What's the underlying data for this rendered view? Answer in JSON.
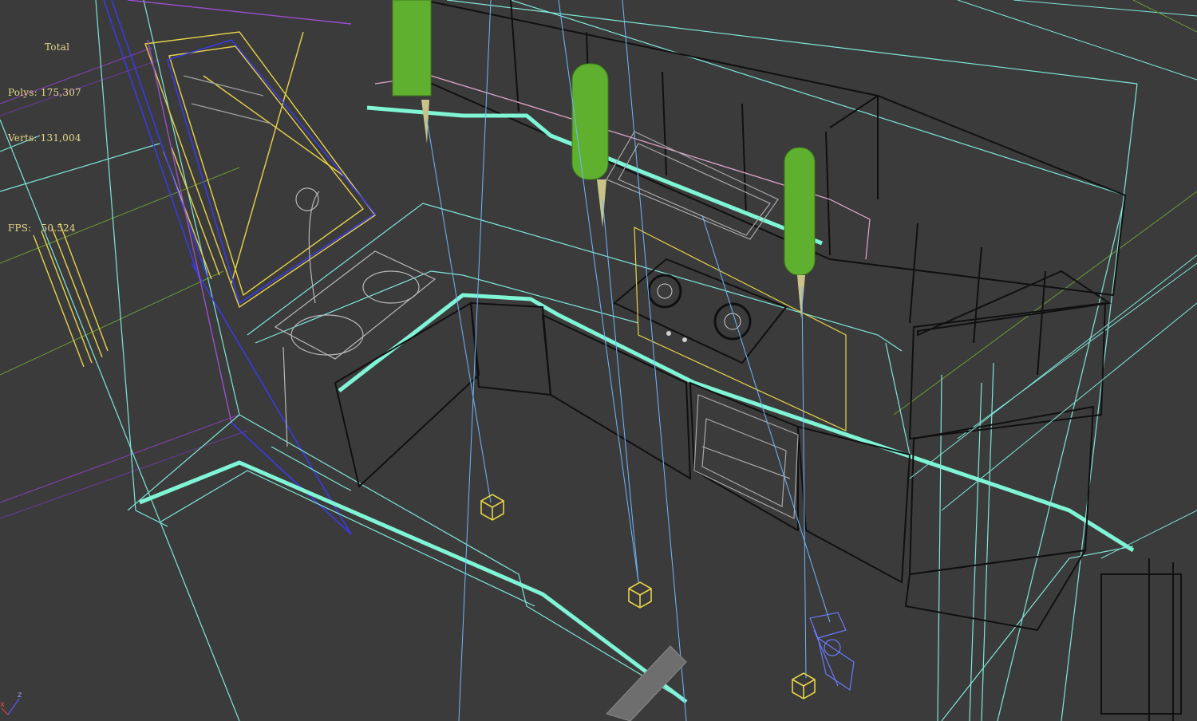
{
  "viewport": {
    "name": "3D wireframe viewport",
    "background": "#3b3b3b"
  },
  "stats": {
    "title": "Total",
    "polys_label": "Polys:",
    "polys_value": "175,307",
    "verts_label": "Verts:",
    "verts_value": "131,004",
    "fps_label": "FPS:",
    "fps_value": "50.524"
  },
  "axis": {
    "x_label": "x",
    "z_label": "z"
  },
  "colors": {
    "cyan": "#7ff5d6",
    "cyan_thin": "#7fe7d8",
    "yellow": "#e8d34a",
    "blue": "#3a3aff",
    "light_blue": "#6fb7ff",
    "purple": "#9a4fd0",
    "pink": "#e7a9cf",
    "green": "#5fb02e",
    "olive": "#9a9a30",
    "black": "#101010",
    "grey": "#a8a8a8"
  },
  "icons": [
    "light-fixture-icon",
    "camera-icon",
    "stove-burner-icon",
    "sink-icon",
    "target-cube-icon"
  ]
}
